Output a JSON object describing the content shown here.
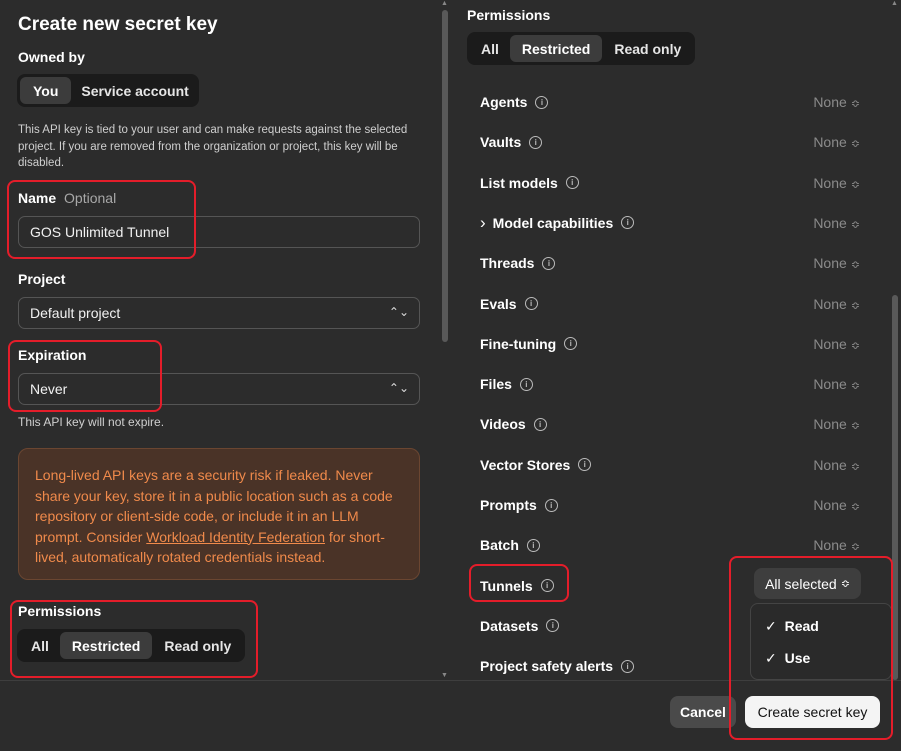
{
  "dialog": {
    "title": "Create new secret key",
    "owned_by_label": "Owned by",
    "owner_options": [
      "You",
      "Service account"
    ],
    "owner_selected": "You",
    "owner_description": "This API key is tied to your user and can make requests against the selected project. If you are removed from the organization or project, this key will be disabled.",
    "name_label": "Name",
    "name_optional": "Optional",
    "name_value": "GOS Unlimited Tunnel",
    "project_label": "Project",
    "project_value": "Default project",
    "expiration_label": "Expiration",
    "expiration_value": "Never",
    "expiration_note": "This API key will not expire.",
    "warning_text_before": "Long-lived API keys are a security risk if leaked. Never share your key, store it in a public location such as a code repository or client-side code, or include it in an LLM prompt. Consider ",
    "warning_link": "Workload Identity Federation",
    "warning_text_after": " for short-lived, automatically rotated credentials instead.",
    "permissions_label": "Permissions",
    "permission_modes": [
      "All",
      "Restricted",
      "Read only"
    ],
    "permission_mode_selected": "Restricted"
  },
  "permissions": {
    "title": "Permissions",
    "modes": [
      "All",
      "Restricted",
      "Read only"
    ],
    "selected_mode": "Restricted",
    "rows": [
      {
        "name": "Agents",
        "value": "None"
      },
      {
        "name": "Vaults",
        "value": "None"
      },
      {
        "name": "List models",
        "value": "None"
      },
      {
        "name": "Model capabilities",
        "value": "None",
        "expandable": true
      },
      {
        "name": "Threads",
        "value": "None"
      },
      {
        "name": "Evals",
        "value": "None"
      },
      {
        "name": "Fine-tuning",
        "value": "None"
      },
      {
        "name": "Files",
        "value": "None"
      },
      {
        "name": "Videos",
        "value": "None"
      },
      {
        "name": "Vector Stores",
        "value": "None"
      },
      {
        "name": "Prompts",
        "value": "None"
      },
      {
        "name": "Batch",
        "value": "None"
      },
      {
        "name": "Tunnels",
        "value": "All selected"
      },
      {
        "name": "Datasets",
        "value": ""
      },
      {
        "name": "Project safety alerts",
        "value": ""
      }
    ],
    "tunnels_dropdown": [
      "Read",
      "Use"
    ]
  },
  "footer": {
    "cancel_label": "Cancel",
    "create_label": "Create secret key"
  },
  "colors": {
    "background": "#2c2c2c",
    "highlight_box": "#e41d2a",
    "warning_text": "#f08a4b",
    "warning_bg": "#4a3327"
  }
}
